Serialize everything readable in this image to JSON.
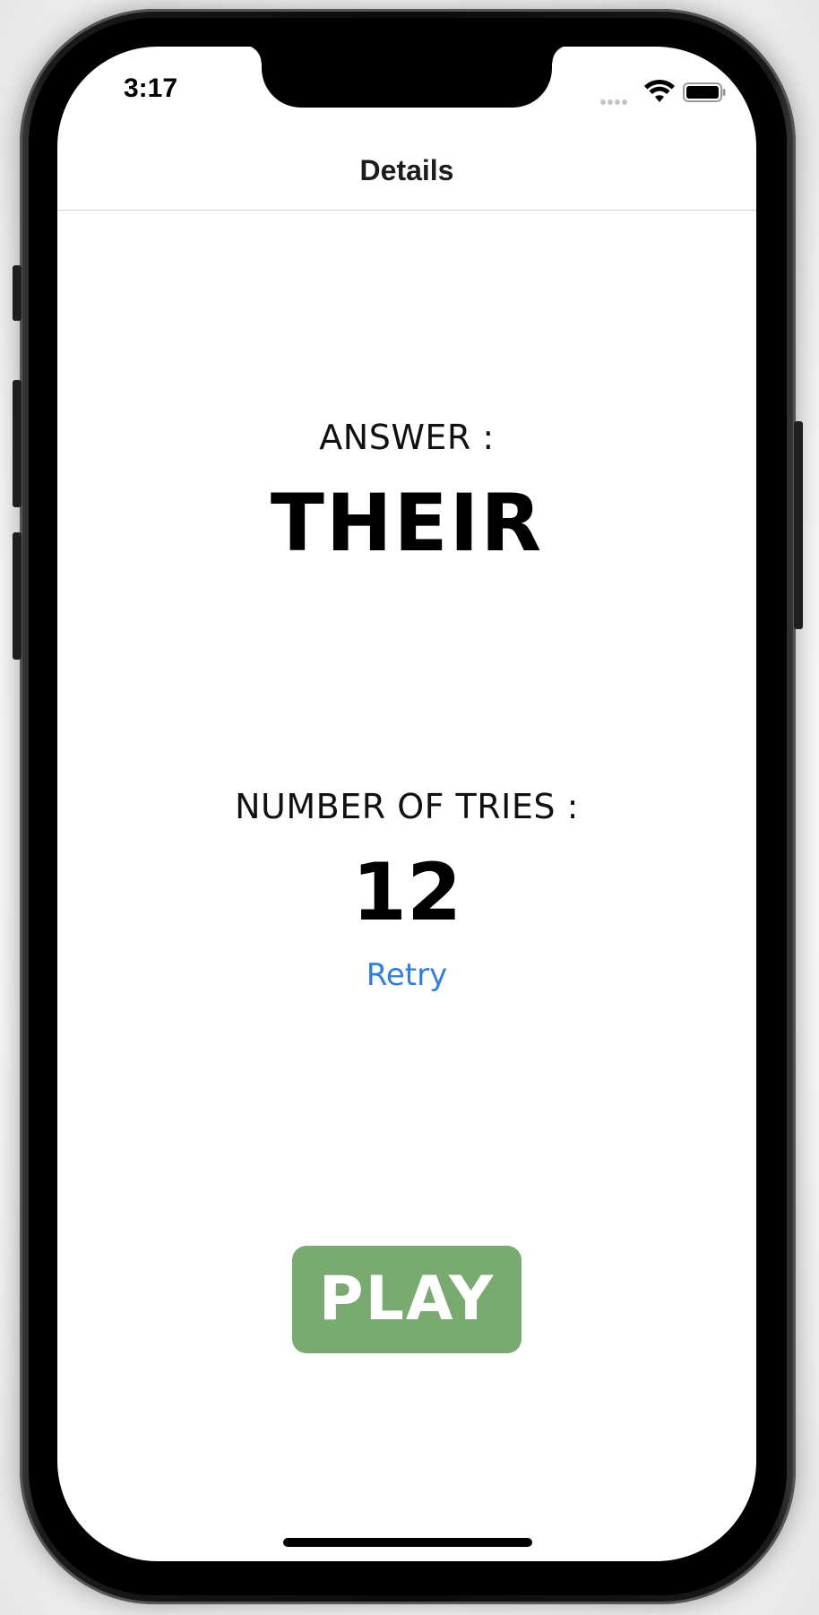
{
  "status_bar": {
    "time": "3:17"
  },
  "nav": {
    "title": "Details"
  },
  "answer": {
    "label": "ANSWER :",
    "value": "THEIR"
  },
  "tries": {
    "label": "NUMBER OF TRIES :",
    "value": "12"
  },
  "actions": {
    "retry_label": "Retry",
    "play_label": "PLAY"
  },
  "colors": {
    "play_button": "#79aa6f",
    "retry_link": "#2f7fe0"
  }
}
